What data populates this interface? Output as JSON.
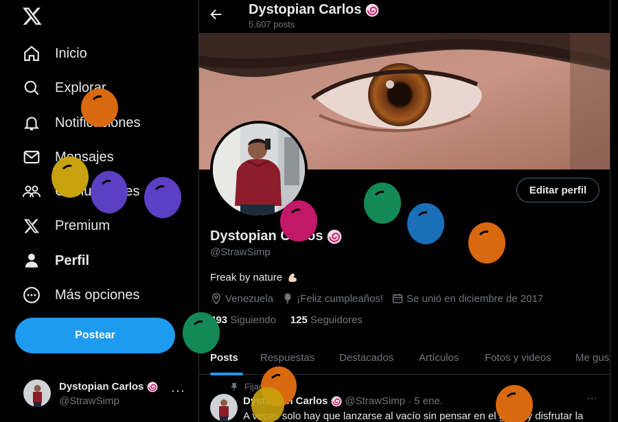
{
  "sidebar": {
    "logo": "x-logo-icon",
    "items": [
      {
        "label": "Inicio",
        "icon": "home-icon"
      },
      {
        "label": "Explorar",
        "icon": "search-icon"
      },
      {
        "label": "Notificaciones",
        "icon": "bell-icon"
      },
      {
        "label": "Mensajes",
        "icon": "mail-icon"
      },
      {
        "label": "Comunidades",
        "icon": "people-icon"
      },
      {
        "label": "Premium",
        "icon": "x-logo-icon"
      },
      {
        "label": "Perfil",
        "icon": "person-icon"
      },
      {
        "label": "Más opciones",
        "icon": "more-circle-icon"
      }
    ],
    "post_label": "Postear",
    "account": {
      "name": "Dystopian Carlos",
      "handle": "@StrawSimp",
      "more": "···"
    }
  },
  "header": {
    "name": "Dystopian Carlos",
    "posts": "5.607 posts"
  },
  "profile": {
    "edit_label": "Editar perfil",
    "name": "Dystopian Carlos",
    "handle": "@StrawSimp",
    "bio": "Freak by nature",
    "location": "Venezuela",
    "birthday": "¡Feliz cumpleaños!",
    "joined": "Se unió en diciembre de 2017",
    "following_count": "493",
    "following_label": "Siguiendo",
    "followers_count": "125",
    "followers_label": "Seguidores"
  },
  "tabs": [
    "Posts",
    "Respuestas",
    "Destacados",
    "Artículos",
    "Fotos y videos",
    "Me gusta"
  ],
  "pinned_label": "Fijado",
  "tweet": {
    "name": "Dystopian Carlos",
    "handle": "@StrawSimp",
    "sep": "·",
    "date": "5 ene.",
    "more": "···",
    "text": "A veces solo hay que lanzarse al vacío sin pensar en el golpe y disfrutar la"
  },
  "colors": {
    "accent": "#1d9bf0",
    "background": "#000000",
    "border": "#2f3336",
    "muted": "#71767b"
  }
}
